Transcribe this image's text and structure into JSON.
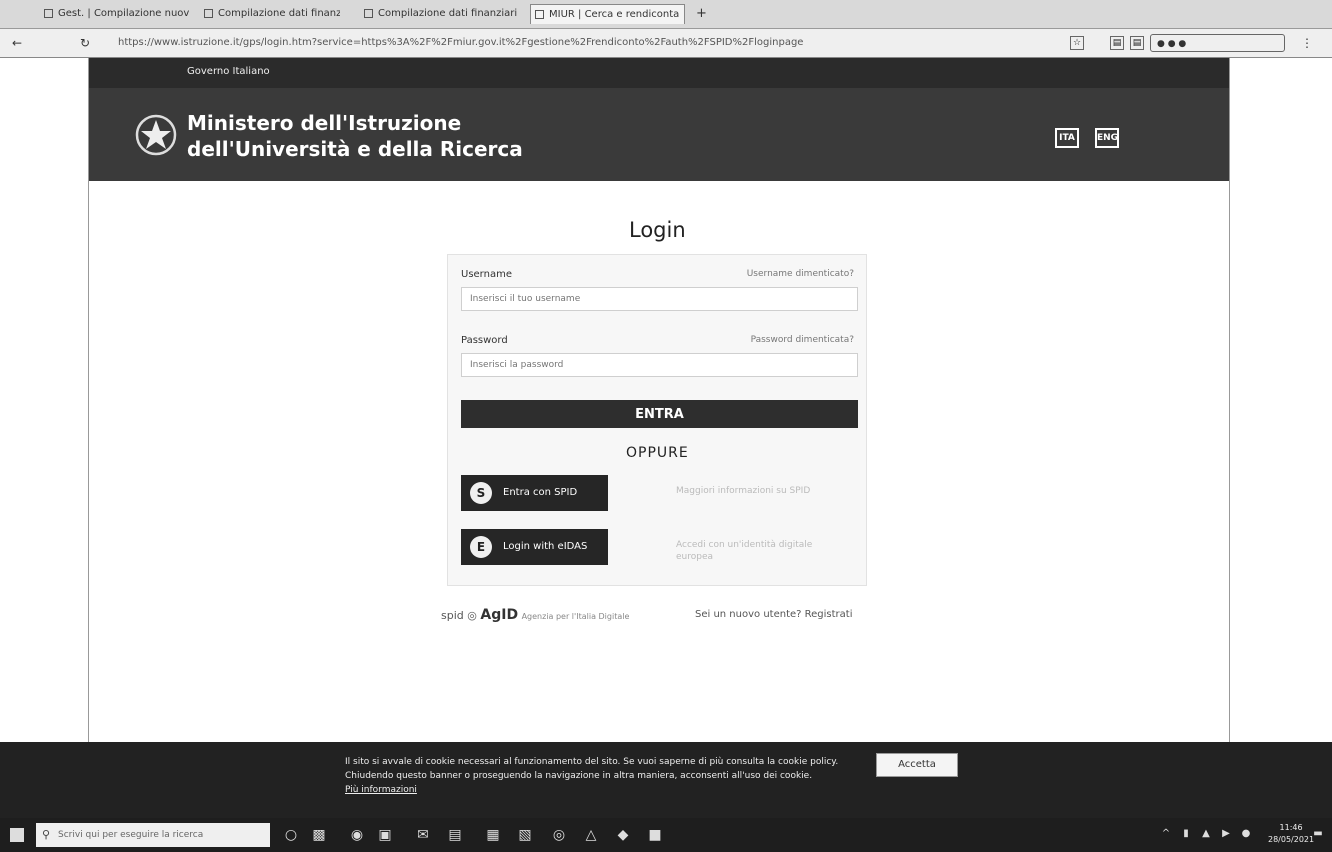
{
  "browser": {
    "tabs": [
      {
        "label": "Gest. | Compilazione nuovi fascicoli"
      },
      {
        "label": "Compilazione dati finanziari"
      },
      {
        "label": "Compilazione dati finanziari"
      },
      {
        "label": "MIUR | Cerca e rendiconta"
      }
    ],
    "new_tab": "+",
    "url": "https://www.istruzione.it/gps/login.htm?service=https%3A%2F%2Fmiur.gov.it%2Fgestione%2Frendiconto%2Fauth%2FSPID%2Floginpage"
  },
  "header": {
    "gov_label": "Governo Italiano",
    "ministry_line1": "Ministero dell'Istruzione",
    "ministry_line2": "dell'Università e della Ricerca",
    "lang_it": "ITA",
    "lang_en": "ENG"
  },
  "login": {
    "title": "Login",
    "username_label": "Username",
    "username_forgot": "Username dimenticato?",
    "username_placeholder": "Inserisci il tuo username",
    "password_label": "Password",
    "password_forgot": "Password dimenticata?",
    "password_placeholder": "Inserisci la password",
    "enter_button": "ENTRA",
    "or_label": "OPPURE",
    "spid_button": "Entra con SPID",
    "spid_icon": "S",
    "spid_note": "Maggiori informazioni su SPID",
    "eidas_button": "Login with eIDAS",
    "eidas_icon": "E",
    "eidas_note": "Accedi con un'identità digitale europea"
  },
  "footer": {
    "agid_prefix": "spid",
    "agid_logo": "AgID",
    "agid_suffix": "Agenzia per l'Italia Digitale",
    "register": "Sei un nuovo utente? Registrati"
  },
  "cookie": {
    "line1": "Il sito si avvale di cookie necessari al funzionamento del sito. Se vuoi saperne di più consulta la cookie policy.",
    "line2": "Chiudendo questo banner o proseguendo la navigazione in altra maniera, acconsenti all'uso dei cookie.",
    "more": "Più informazioni",
    "accept": "Accetta"
  },
  "taskbar": {
    "search_placeholder": "Scrivi qui per eseguire la ricerca",
    "time": "11:46",
    "date": "28/05/2021"
  },
  "colors": {
    "masthead": "#3a3a3a",
    "gov_strip": "#2b2b2b",
    "button_dark": "#2e2e2e"
  }
}
